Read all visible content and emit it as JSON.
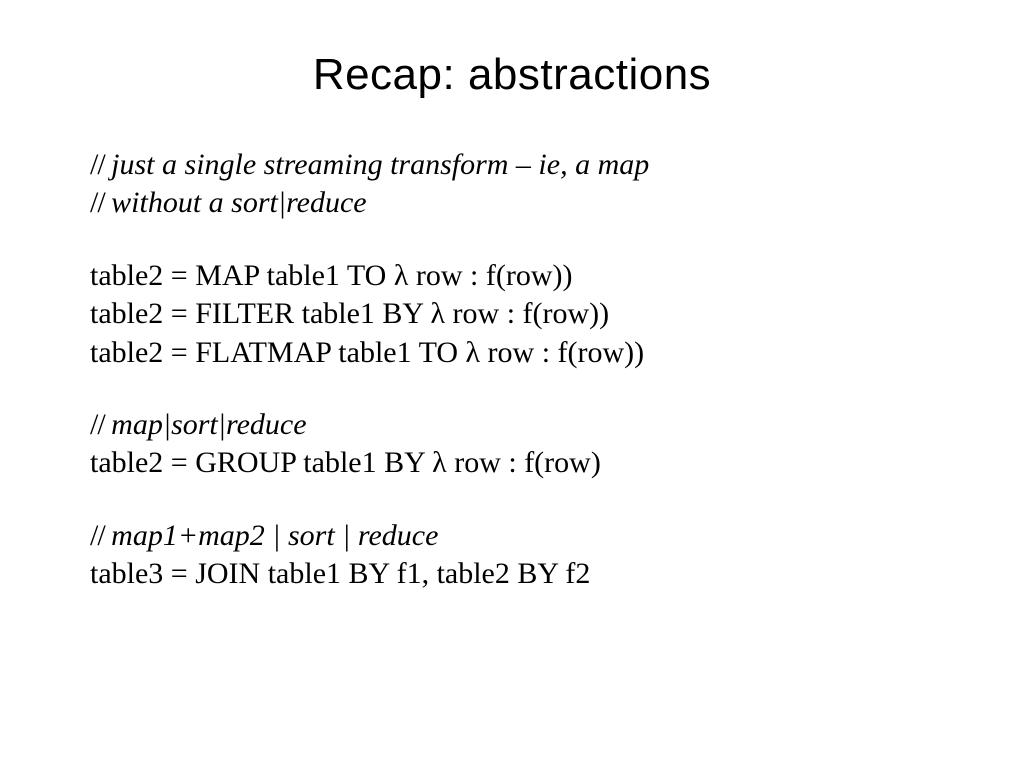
{
  "title": "Recap: abstractions",
  "block1": {
    "comment1": "just a single streaming transform – ie, a map",
    "comment2": "without a sort|reduce"
  },
  "block2": {
    "line1": "table2 = MAP table1  TO λ row : f(row))",
    "line2": "table2 = FILTER table1  BY λ row : f(row))",
    "line3": "table2 = FLATMAP table1  TO λ row : f(row))"
  },
  "block3": {
    "comment": "map|sort|reduce",
    "line1": "table2 = GROUP table1  BY  λ row : f(row)"
  },
  "block4": {
    "comment": "map1+map2 | sort | reduce",
    "line1": "table3 =  JOIN table1 BY f1, table2 BY f2"
  },
  "slashes": "// "
}
